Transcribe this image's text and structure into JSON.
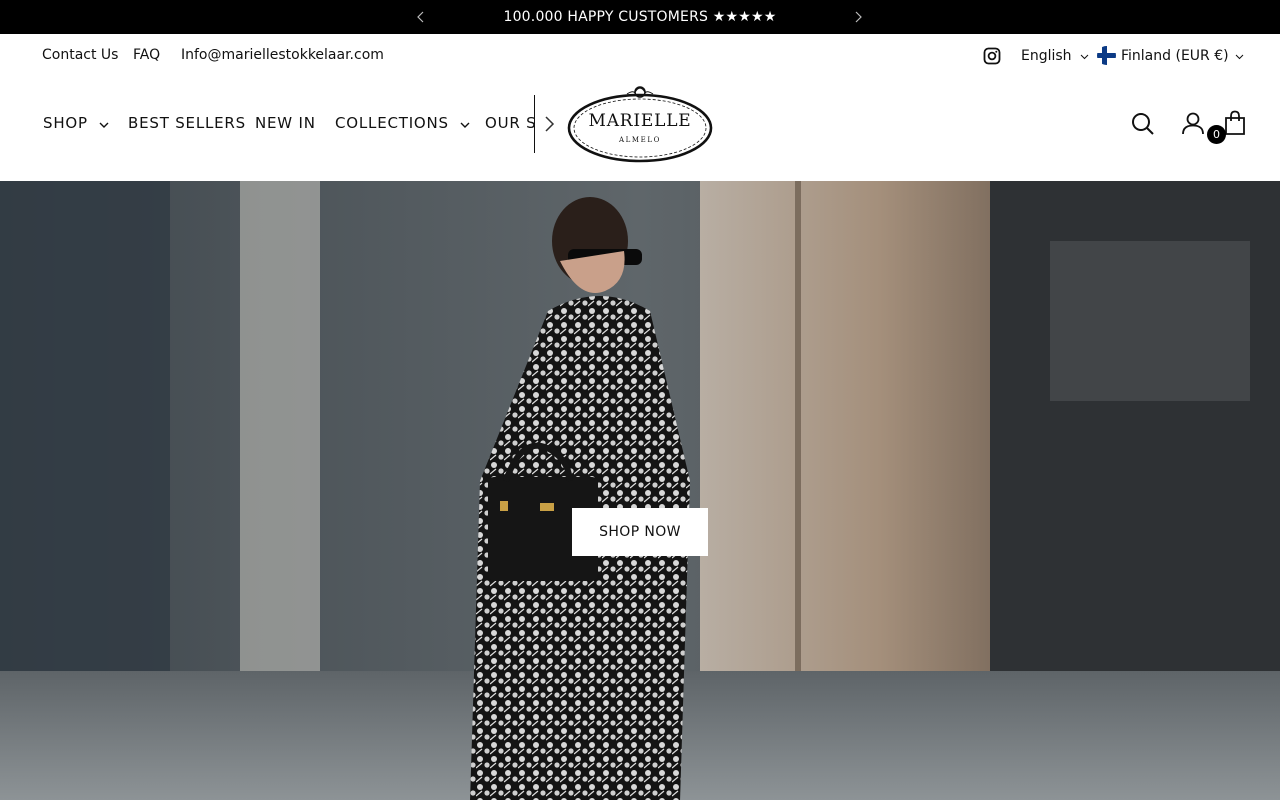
{
  "announcement": {
    "text": "100.000 HAPPY CUSTOMERS ★★★★★"
  },
  "utility": {
    "links": [
      {
        "label": "Contact Us"
      },
      {
        "label": "FAQ"
      },
      {
        "label": "Info@mariellestokkelaar.com"
      }
    ],
    "language": "English",
    "country": "Finland (EUR €)"
  },
  "nav": {
    "items": [
      {
        "label": "SHOP",
        "has_dropdown": true
      },
      {
        "label": "BEST SELLERS",
        "has_dropdown": false
      },
      {
        "label": "NEW IN",
        "has_dropdown": false
      },
      {
        "label": "COLLECTIONS",
        "has_dropdown": true
      },
      {
        "label": "OUR STORY",
        "has_dropdown": false
      }
    ]
  },
  "logo": {
    "name": "MARIELLE",
    "sub": "ALMELO"
  },
  "cart": {
    "count": "0"
  },
  "hero": {
    "button_label": "SHOP NOW"
  },
  "icons": {
    "announce_prev": "chevron-left-icon",
    "announce_next": "chevron-right-icon",
    "social": "instagram-icon",
    "search": "search-icon",
    "account": "user-icon",
    "cart": "shopping-bag-icon"
  },
  "colors": {
    "announcement_bg": "#000000",
    "text": "#111111",
    "badge": "#000000",
    "flag_blue": "#0b3a85"
  }
}
